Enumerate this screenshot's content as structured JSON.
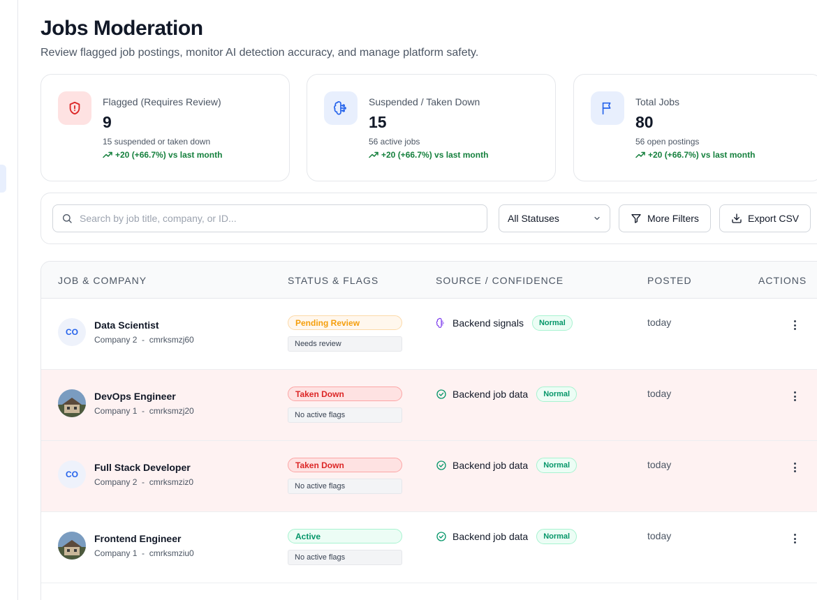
{
  "page": {
    "title": "Jobs Moderation",
    "subtitle": "Review flagged job postings, monitor AI detection accuracy, and manage platform safety."
  },
  "stats": [
    {
      "label": "Flagged (Requires Review)",
      "value": "9",
      "sub": "15 suspended or taken down",
      "trend": "+20 (+66.7%) vs last month",
      "icon": "shield-alert-icon",
      "icon_color": "#dc2626",
      "icon_bg": "#fee2e2"
    },
    {
      "label": "Suspended / Taken Down",
      "value": "15",
      "sub": "56 active jobs",
      "trend": "+20 (+66.7%) vs last month",
      "icon": "brain-icon",
      "icon_color": "#2563eb",
      "icon_bg": "#e8effd"
    },
    {
      "label": "Total Jobs",
      "value": "80",
      "sub": "56 open postings",
      "trend": "+20 (+66.7%) vs last month",
      "icon": "flag-icon",
      "icon_color": "#2563eb",
      "icon_bg": "#e8effd"
    }
  ],
  "toolbar": {
    "search_placeholder": "Search by job title, company, or ID...",
    "status_select": "All Statuses",
    "more_filters": "More Filters",
    "export": "Export CSV"
  },
  "table": {
    "columns": [
      "JOB & COMPANY",
      "STATUS & FLAGS",
      "SOURCE / CONFIDENCE",
      "POSTED",
      "ACTIONS"
    ],
    "rows": [
      {
        "title": "Data Scientist",
        "company": "Company 2",
        "sep": "-",
        "id": "cmrksmzj60",
        "avatar": "CO",
        "avatar_type": "initials",
        "status": "Pending Review",
        "status_kind": "pending",
        "flag": "Needs review",
        "source": "Backend signals",
        "source_icon": "brain-icon",
        "confidence": "Normal",
        "posted": "today",
        "danger": false
      },
      {
        "title": "DevOps Engineer",
        "company": "Company 1",
        "sep": "-",
        "id": "cmrksmzj20",
        "avatar": "",
        "avatar_type": "photo",
        "status": "Taken Down",
        "status_kind": "down",
        "flag": "No active flags",
        "source": "Backend job data",
        "source_icon": "check-circle-icon",
        "confidence": "Normal",
        "posted": "today",
        "danger": true
      },
      {
        "title": "Full Stack Developer",
        "company": "Company 2",
        "sep": "-",
        "id": "cmrksmziz0",
        "avatar": "CO",
        "avatar_type": "initials",
        "status": "Taken Down",
        "status_kind": "down",
        "flag": "No active flags",
        "source": "Backend job data",
        "source_icon": "check-circle-icon",
        "confidence": "Normal",
        "posted": "today",
        "danger": true
      },
      {
        "title": "Frontend Engineer",
        "company": "Company 1",
        "sep": "-",
        "id": "cmrksmziu0",
        "avatar": "",
        "avatar_type": "photo",
        "status": "Active",
        "status_kind": "active",
        "flag": "No active flags",
        "source": "Backend job data",
        "source_icon": "check-circle-icon",
        "confidence": "Normal",
        "posted": "today",
        "danger": false
      }
    ]
  },
  "colors": {
    "accent": "#2563eb",
    "danger": "#dc2626",
    "success": "#059669",
    "warning": "#f59e0b",
    "danger_row_bg": "#fef2f2"
  }
}
